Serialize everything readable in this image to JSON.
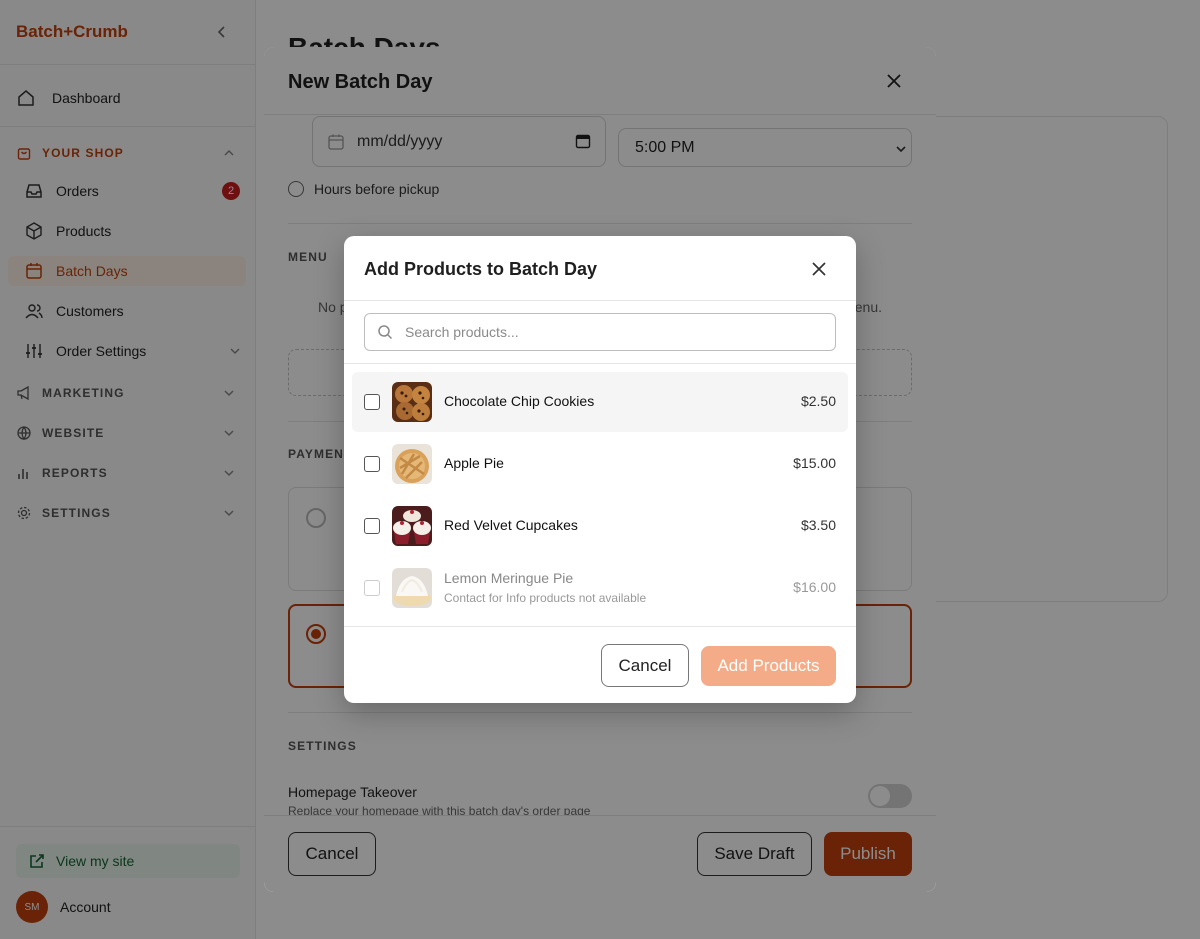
{
  "sidebar": {
    "brand": "Batch+Crumb",
    "items": {
      "dashboard": "Dashboard",
      "your_shop": "YOUR SHOP",
      "orders": "Orders",
      "orders_badge": "2",
      "products": "Products",
      "batch_days": "Batch Days",
      "customers": "Customers",
      "order_settings": "Order Settings",
      "marketing": "MARKETING",
      "website": "WEBSITE",
      "reports": "REPORTS",
      "settings": "SETTINGS"
    },
    "view_site": "View my site",
    "account": "Account",
    "avatar_initials": "SM"
  },
  "page": {
    "title": "Batch Days"
  },
  "batch_modal": {
    "title": "New Batch Day",
    "date_placeholder": "mm/dd/yyyy",
    "time_value": "5:00 PM",
    "hours_before_label": "Hours before pickup",
    "menu_label": "MENU",
    "menu_empty_left": "No p",
    "menu_empty_right": "enu.",
    "payment_label": "PAYMENT",
    "settings_label": "SETTINGS",
    "homepage_title": "Homepage Takeover",
    "homepage_desc": "Replace your homepage with this batch day's order page",
    "cancel": "Cancel",
    "save_draft": "Save Draft",
    "publish": "Publish"
  },
  "add_products_modal": {
    "title": "Add Products to Batch Day",
    "search_placeholder": "Search products...",
    "products": [
      {
        "name": "Chocolate Chip Cookies",
        "price": "$2.50",
        "note": ""
      },
      {
        "name": "Apple Pie",
        "price": "$15.00",
        "note": ""
      },
      {
        "name": "Red Velvet Cupcakes",
        "price": "$3.50",
        "note": ""
      },
      {
        "name": "Lemon Meringue Pie",
        "price": "$16.00",
        "note": "Contact for Info products not available"
      }
    ],
    "cancel": "Cancel",
    "add": "Add Products"
  },
  "colors": {
    "accent": "#c2410c",
    "accent_disabled": "#f4ab87",
    "view_site_bg": "#e9f5ec"
  }
}
